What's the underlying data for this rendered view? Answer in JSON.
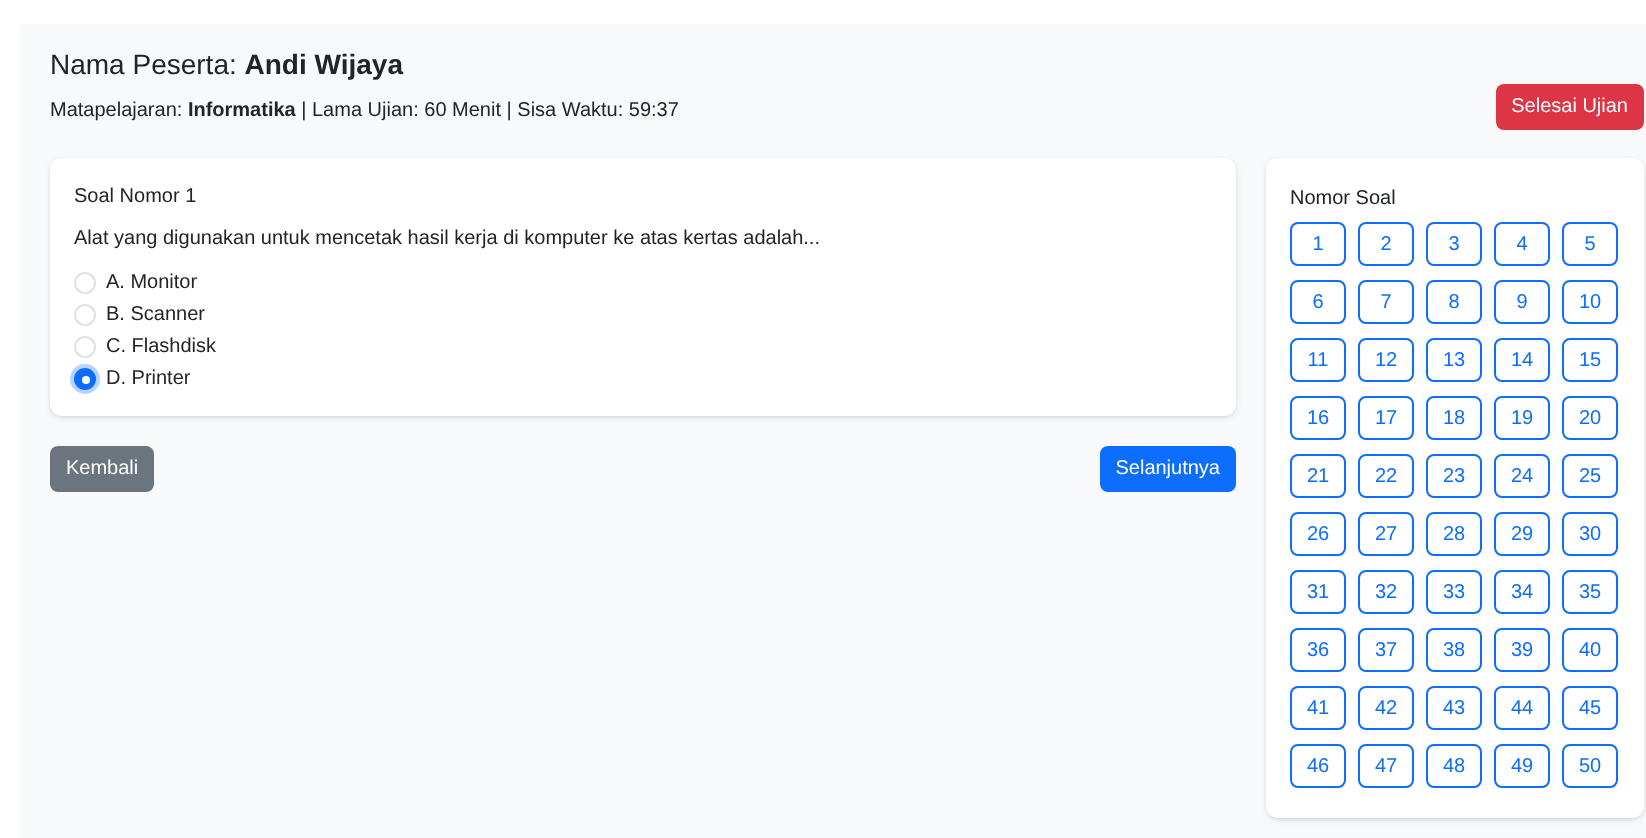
{
  "header": {
    "participant": "Nama Peserta: **Andi Wijaya**",
    "info": "Matapelajaran: **Informatika** | Lama Ujian: 60 Menit | Sisa Waktu: 59:37",
    "finish_button": "Selesai Ujian"
  },
  "question": {
    "title": "Soal Nomor 1",
    "text": "Alat yang digunakan untuk mencetak hasil kerja di komputer ke atas kertas adalah...",
    "options": [
      {
        "label": "A. Monitor",
        "selected": false
      },
      {
        "label": "B. Scanner",
        "selected": false
      },
      {
        "label": "C. Flashdisk",
        "selected": false
      },
      {
        "label": "D. Printer",
        "selected": true
      }
    ]
  },
  "navigation": {
    "back_button": "Kembali",
    "next_button": "Selanjutnya"
  },
  "question_panel": {
    "title": "Nomor Soal",
    "numbers": [
      "1",
      "2",
      "3",
      "4",
      "5",
      "6",
      "7",
      "8",
      "9",
      "10",
      "11",
      "12",
      "13",
      "14",
      "15",
      "16",
      "17",
      "18",
      "19",
      "20",
      "21",
      "22",
      "23",
      "24",
      "25",
      "26",
      "27",
      "28",
      "29",
      "30",
      "31",
      "32",
      "33",
      "34",
      "35",
      "36",
      "37",
      "38",
      "39",
      "40",
      "41",
      "42",
      "43",
      "44",
      "45",
      "46",
      "47",
      "48",
      "49",
      "50"
    ]
  }
}
